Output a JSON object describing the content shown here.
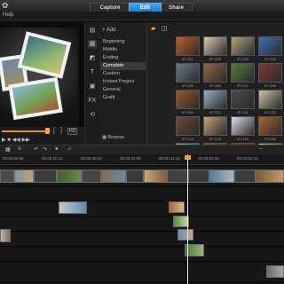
{
  "menubar": {
    "help_label": "Help"
  },
  "mode_tabs": [
    {
      "label": "Capture"
    },
    {
      "label": "Edit",
      "active": true
    },
    {
      "label": "Share"
    }
  ],
  "colors": {
    "accent": "#2a8ee0",
    "highlight": "#f28a1a"
  },
  "player": {
    "scrub_progress": 0.92,
    "hd_label": "HD"
  },
  "library": {
    "add_label": "Add",
    "browse_label": "Browse",
    "categories": [
      {
        "label": "Beginning"
      },
      {
        "label": "Middle"
      },
      {
        "label": "Ending"
      },
      {
        "label": "Complete",
        "active": true
      },
      {
        "label": "Custom"
      },
      {
        "label": "Instant Project"
      },
      {
        "label": "General"
      },
      {
        "label": "Grafit"
      }
    ],
    "thumbnails": [
      {
        "label": "IP-C01",
        "color": "#c95a2a"
      },
      {
        "label": "IP-C02",
        "color": "#d8cbb0"
      },
      {
        "label": "IP-C03",
        "color": "#b3a77f"
      },
      {
        "label": "IP-C04",
        "color": "#3c73b8"
      },
      {
        "label": "IP-C05",
        "color": "#6c7a8a"
      },
      {
        "label": "IP-C06",
        "color": "#8a6a4a"
      },
      {
        "label": "IP-C07",
        "color": "#5a7a3a"
      },
      {
        "label": "IP-C08",
        "color": "#7a3a3a"
      },
      {
        "label": "IP-C09",
        "color": "#9a5a2a"
      },
      {
        "label": "IP-C10",
        "color": "#9ab0c0"
      },
      {
        "label": "IP-C11",
        "color": "#4a4a4a"
      },
      {
        "label": "IP-C12",
        "color": "#c8c0a8"
      },
      {
        "label": "IP-C13",
        "color": "#6a4a3a"
      },
      {
        "label": "IP-C14",
        "color": "#c0a878"
      },
      {
        "label": "IP-C15",
        "color": "#d8e0e8"
      },
      {
        "label": "IP-C16",
        "color": "#a86830"
      },
      {
        "label": "IP-C17",
        "color": "#8aa8c8"
      },
      {
        "label": "IP-C18",
        "color": "#c84030"
      },
      {
        "label": "IP-C19",
        "color": "#a03020"
      },
      {
        "label": "IP-C20",
        "color": "#c8b070"
      }
    ]
  },
  "timeline": {
    "timecodes": [
      "00:00:00:00",
      "00:00:10:12",
      "00:00:20:24",
      "00:00:31:06",
      "00:00:41:18",
      "00:00:52:00",
      "00:01:02:12"
    ]
  }
}
